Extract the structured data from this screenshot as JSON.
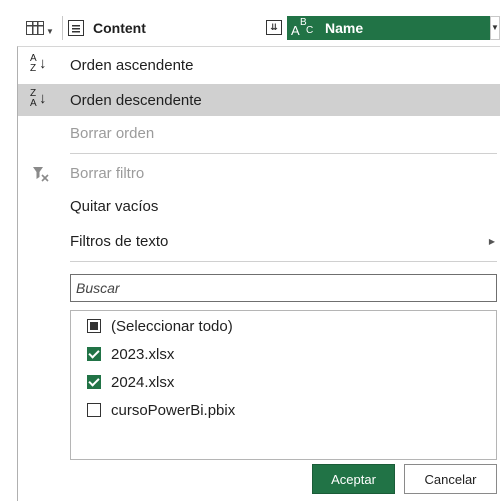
{
  "header": {
    "content_label": "Content",
    "name_label": "Name",
    "name_type_icon": {
      "a": "A",
      "b": "B",
      "c": "C"
    },
    "accent_color": "#217346"
  },
  "menu": {
    "sort_ascending": "Orden ascendente",
    "sort_descending": "Orden descendente",
    "clear_sort": "Borrar orden",
    "clear_filter": "Borrar filtro",
    "remove_empty": "Quitar vacíos",
    "text_filters": "Filtros de texto",
    "asc_icon": {
      "top": "A",
      "bottom": "Z"
    },
    "desc_icon": {
      "top": "Z",
      "bottom": "A"
    }
  },
  "search": {
    "placeholder": "Buscar"
  },
  "filter_list": {
    "items": [
      {
        "label": "(Seleccionar todo)",
        "state": "partial"
      },
      {
        "label": "2023.xlsx",
        "state": "checked"
      },
      {
        "label": "2024.xlsx",
        "state": "checked"
      },
      {
        "label": "cursoPowerBi.pbix",
        "state": "unchecked"
      }
    ]
  },
  "buttons": {
    "ok": "Aceptar",
    "cancel": "Cancelar"
  }
}
